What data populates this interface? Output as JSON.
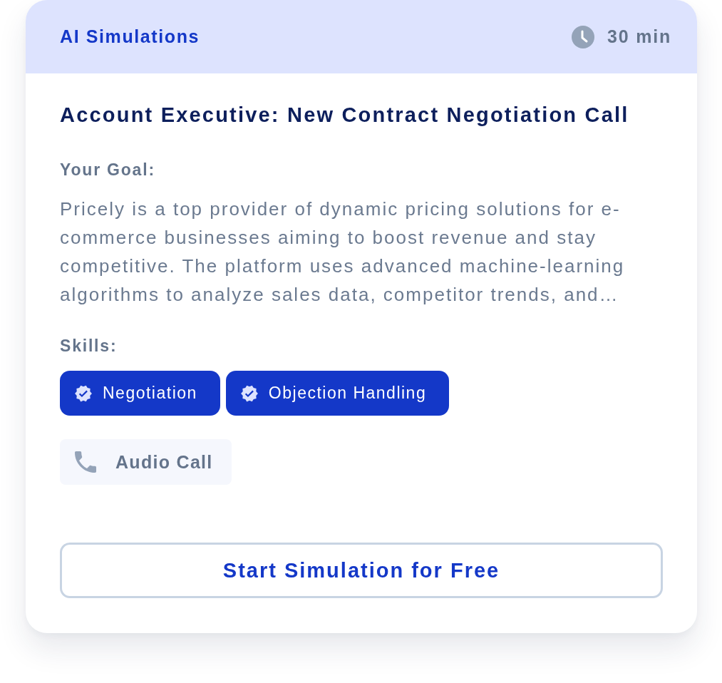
{
  "header": {
    "category": "AI Simulations",
    "duration": "30 min"
  },
  "title": "Account Executive: New Contract Negotiation Call",
  "goal": {
    "label": "Your Goal:",
    "text": "Pricely is a top provider of dynamic pricing solutions for e-commerce businesses aiming to boost revenue and stay competitive. The platform uses advanced machine-learning algorithms to analyze sales data, competitor trends, and…"
  },
  "skills": {
    "label": "Skills:",
    "items": [
      "Negotiation",
      "Objection Handling"
    ]
  },
  "mode": {
    "kind": "audio",
    "label": "Audio Call"
  },
  "button": {
    "label": "Start Simulation for Free"
  }
}
